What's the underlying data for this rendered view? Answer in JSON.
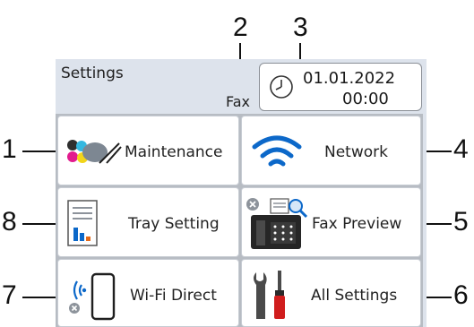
{
  "callouts": {
    "n1": "1",
    "n2": "2",
    "n3": "3",
    "n4": "4",
    "n5": "5",
    "n6": "6",
    "n7": "7",
    "n8": "8"
  },
  "header": {
    "title": "Settings",
    "fax_indicator": "Fax",
    "date": "01.01.2022",
    "time": "00:00",
    "icon": "clock-icon"
  },
  "tiles": [
    {
      "label": "Maintenance",
      "icon": "ink-toner-icon"
    },
    {
      "label": "Network",
      "icon": "wifi-signal-icon"
    },
    {
      "label": "Tray Setting",
      "icon": "tray-paper-icon"
    },
    {
      "label": "Fax Preview",
      "icon": "fax-machine-icon"
    },
    {
      "label": "Wi-Fi Direct",
      "icon": "wifi-direct-icon"
    },
    {
      "label": "All Settings",
      "icon": "tools-icon"
    }
  ],
  "colors": {
    "panel_background": "#dde3ec",
    "wifi_blue": "#0c68c9",
    "tool_red": "#d01d1d",
    "status_gray": "#8d939b"
  }
}
